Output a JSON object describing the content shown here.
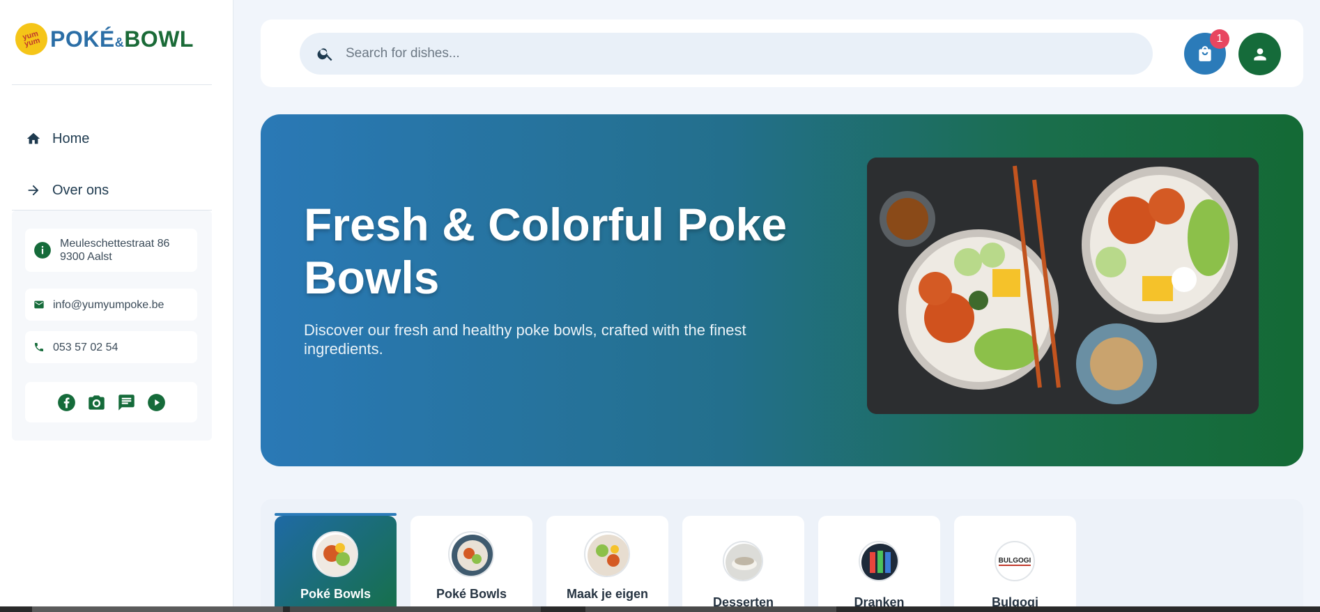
{
  "brand": {
    "badge_text": "yum yum",
    "name_left": "POKÉ",
    "name_amp": "&",
    "name_right": "BOWL"
  },
  "nav": {
    "items": [
      {
        "label": "Home",
        "icon": "home-icon"
      },
      {
        "label": "Over ons",
        "icon": "arrow-right-icon"
      }
    ]
  },
  "contact": {
    "address_line1": "Meuleschettestraat 86",
    "address_line2": "9300 Aalst",
    "email": "info@yumyumpoke.be",
    "phone": "053 57 02 54",
    "socials": [
      "facebook-icon",
      "instagram-camera-icon",
      "chat-icon",
      "youtube-play-icon"
    ]
  },
  "search": {
    "placeholder": "Search for dishes..."
  },
  "cart": {
    "count": "1"
  },
  "hero": {
    "title": "Fresh & Colorful Poke Bowls",
    "subtitle": "Discover our fresh and healthy poke bowls, crafted with the finest ingredients."
  },
  "categories": [
    {
      "label": "Poké Bowls",
      "active": true
    },
    {
      "label": "Poké Bowls",
      "active": false
    },
    {
      "label": "Maak je eigen",
      "active": false
    },
    {
      "label": "Desserten",
      "active": false
    },
    {
      "label": "Dranken",
      "active": false
    },
    {
      "label": "Bulgogi",
      "active": false
    }
  ],
  "bulgogi_logo_text": "BULGOGI",
  "colors": {
    "primary_blue": "#2b7bb9",
    "primary_green": "#156b3a",
    "badge_red": "#e84660"
  }
}
